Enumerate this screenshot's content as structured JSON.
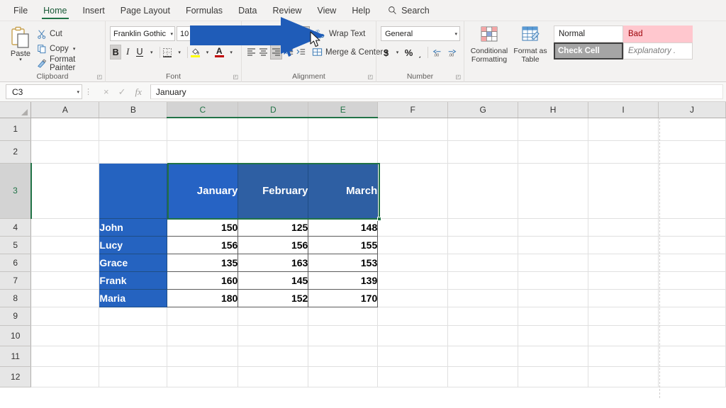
{
  "app": {
    "tabs": [
      {
        "label": "File",
        "active": false
      },
      {
        "label": "Home",
        "active": true
      },
      {
        "label": "Insert",
        "active": false
      },
      {
        "label": "Page Layout",
        "active": false
      },
      {
        "label": "Formulas",
        "active": false
      },
      {
        "label": "Data",
        "active": false
      },
      {
        "label": "Review",
        "active": false
      },
      {
        "label": "View",
        "active": false
      },
      {
        "label": "Help",
        "active": false
      }
    ],
    "search_label": "Search"
  },
  "ribbon": {
    "clipboard": {
      "group_label": "Clipboard",
      "paste_label": "Paste",
      "cut_label": "Cut",
      "copy_label": "Copy",
      "format_painter_label": "Format Painter"
    },
    "font": {
      "group_label": "Font",
      "font_name": "Franklin Gothic ",
      "font_size": "10",
      "bold_label": "B",
      "italic_label": "I",
      "underline_label": "U",
      "bold_active": true,
      "fill_color": "#ffff00",
      "font_color": "#c00000"
    },
    "alignment": {
      "group_label": "Alignment",
      "wrap_text_label": "Wrap Text",
      "merge_center_label": "Merge & Center",
      "orientation_name": "orientation-button",
      "highlighted_button": "orientation-button"
    },
    "number": {
      "group_label": "Number",
      "format": "General",
      "currency_label": "$",
      "percent_label": "%",
      "comma_label": "͵"
    },
    "styles": {
      "conditional_formatting_label": "Conditional Formatting",
      "format_as_table_label": "Format as Table",
      "cell_styles": [
        {
          "label": "Normal",
          "variant": "normal"
        },
        {
          "label": "Bad",
          "variant": "bad"
        },
        {
          "label": "Check Cell",
          "variant": "check"
        },
        {
          "label": "Explanatory .",
          "variant": "expl"
        }
      ]
    }
  },
  "formula_bar": {
    "name_box": "C3",
    "formula_value": "January",
    "cancel_icon": "×",
    "enter_icon": "✓",
    "fx_label": "fx"
  },
  "sheet": {
    "columns": [
      "A",
      "B",
      "C",
      "D",
      "E",
      "F",
      "G",
      "H",
      "I",
      "J"
    ],
    "selected_columns": [
      "C",
      "D",
      "E"
    ],
    "rows": [
      "1",
      "2",
      "3",
      "4",
      "5",
      "6",
      "7",
      "8",
      "9",
      "10",
      "11",
      "12"
    ],
    "selected_rows": [
      "3"
    ],
    "active_cell": "C3",
    "selection_range": "C3:E3",
    "table": {
      "header_row_label": "3",
      "headers": [
        "January",
        "February",
        "March"
      ],
      "data_rows": [
        {
          "row": "4",
          "name": "John",
          "values": [
            "150",
            "125",
            "148"
          ]
        },
        {
          "row": "5",
          "name": "Lucy",
          "values": [
            "156",
            "156",
            "155"
          ]
        },
        {
          "row": "6",
          "name": "Grace",
          "values": [
            "135",
            "163",
            "153"
          ]
        },
        {
          "row": "7",
          "name": "Frank",
          "values": [
            "160",
            "145",
            "139"
          ]
        },
        {
          "row": "8",
          "name": "Maria",
          "values": [
            "180",
            "152",
            "170"
          ]
        }
      ]
    }
  },
  "colors": {
    "excel_green": "#217346",
    "header_blue": "#2e5fa3",
    "active_header_blue": "#2663c4",
    "name_blue": "#2563c0",
    "arrow_blue": "#1f5cb8",
    "ribbon_bg": "#f3f2f1"
  }
}
